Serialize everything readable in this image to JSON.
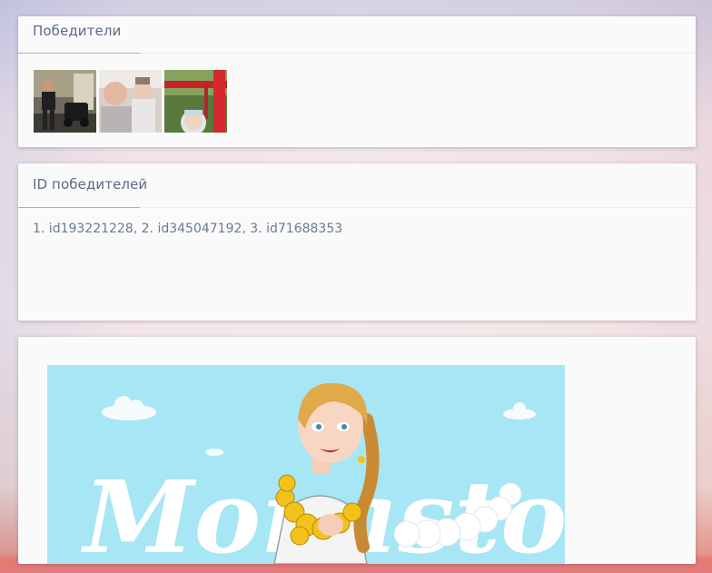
{
  "winners_card": {
    "title": "Победители",
    "photos": [
      {
        "name": "winner-photo-1"
      },
      {
        "name": "winner-photo-2"
      },
      {
        "name": "winner-photo-3"
      }
    ]
  },
  "ids_card": {
    "title": "ID победителей",
    "text": "1. id193221228, 2. id345047192, 3. id71688353"
  },
  "banner": {
    "logo_text": "Monasto",
    "colors": {
      "sky": "#a7e6f5",
      "hair": "#e2a94a",
      "coins": "#f2c21b"
    }
  },
  "colors": {
    "title_text": "#5c6a86",
    "body_text": "#6b7a93",
    "card_bg": "#fafafa"
  }
}
